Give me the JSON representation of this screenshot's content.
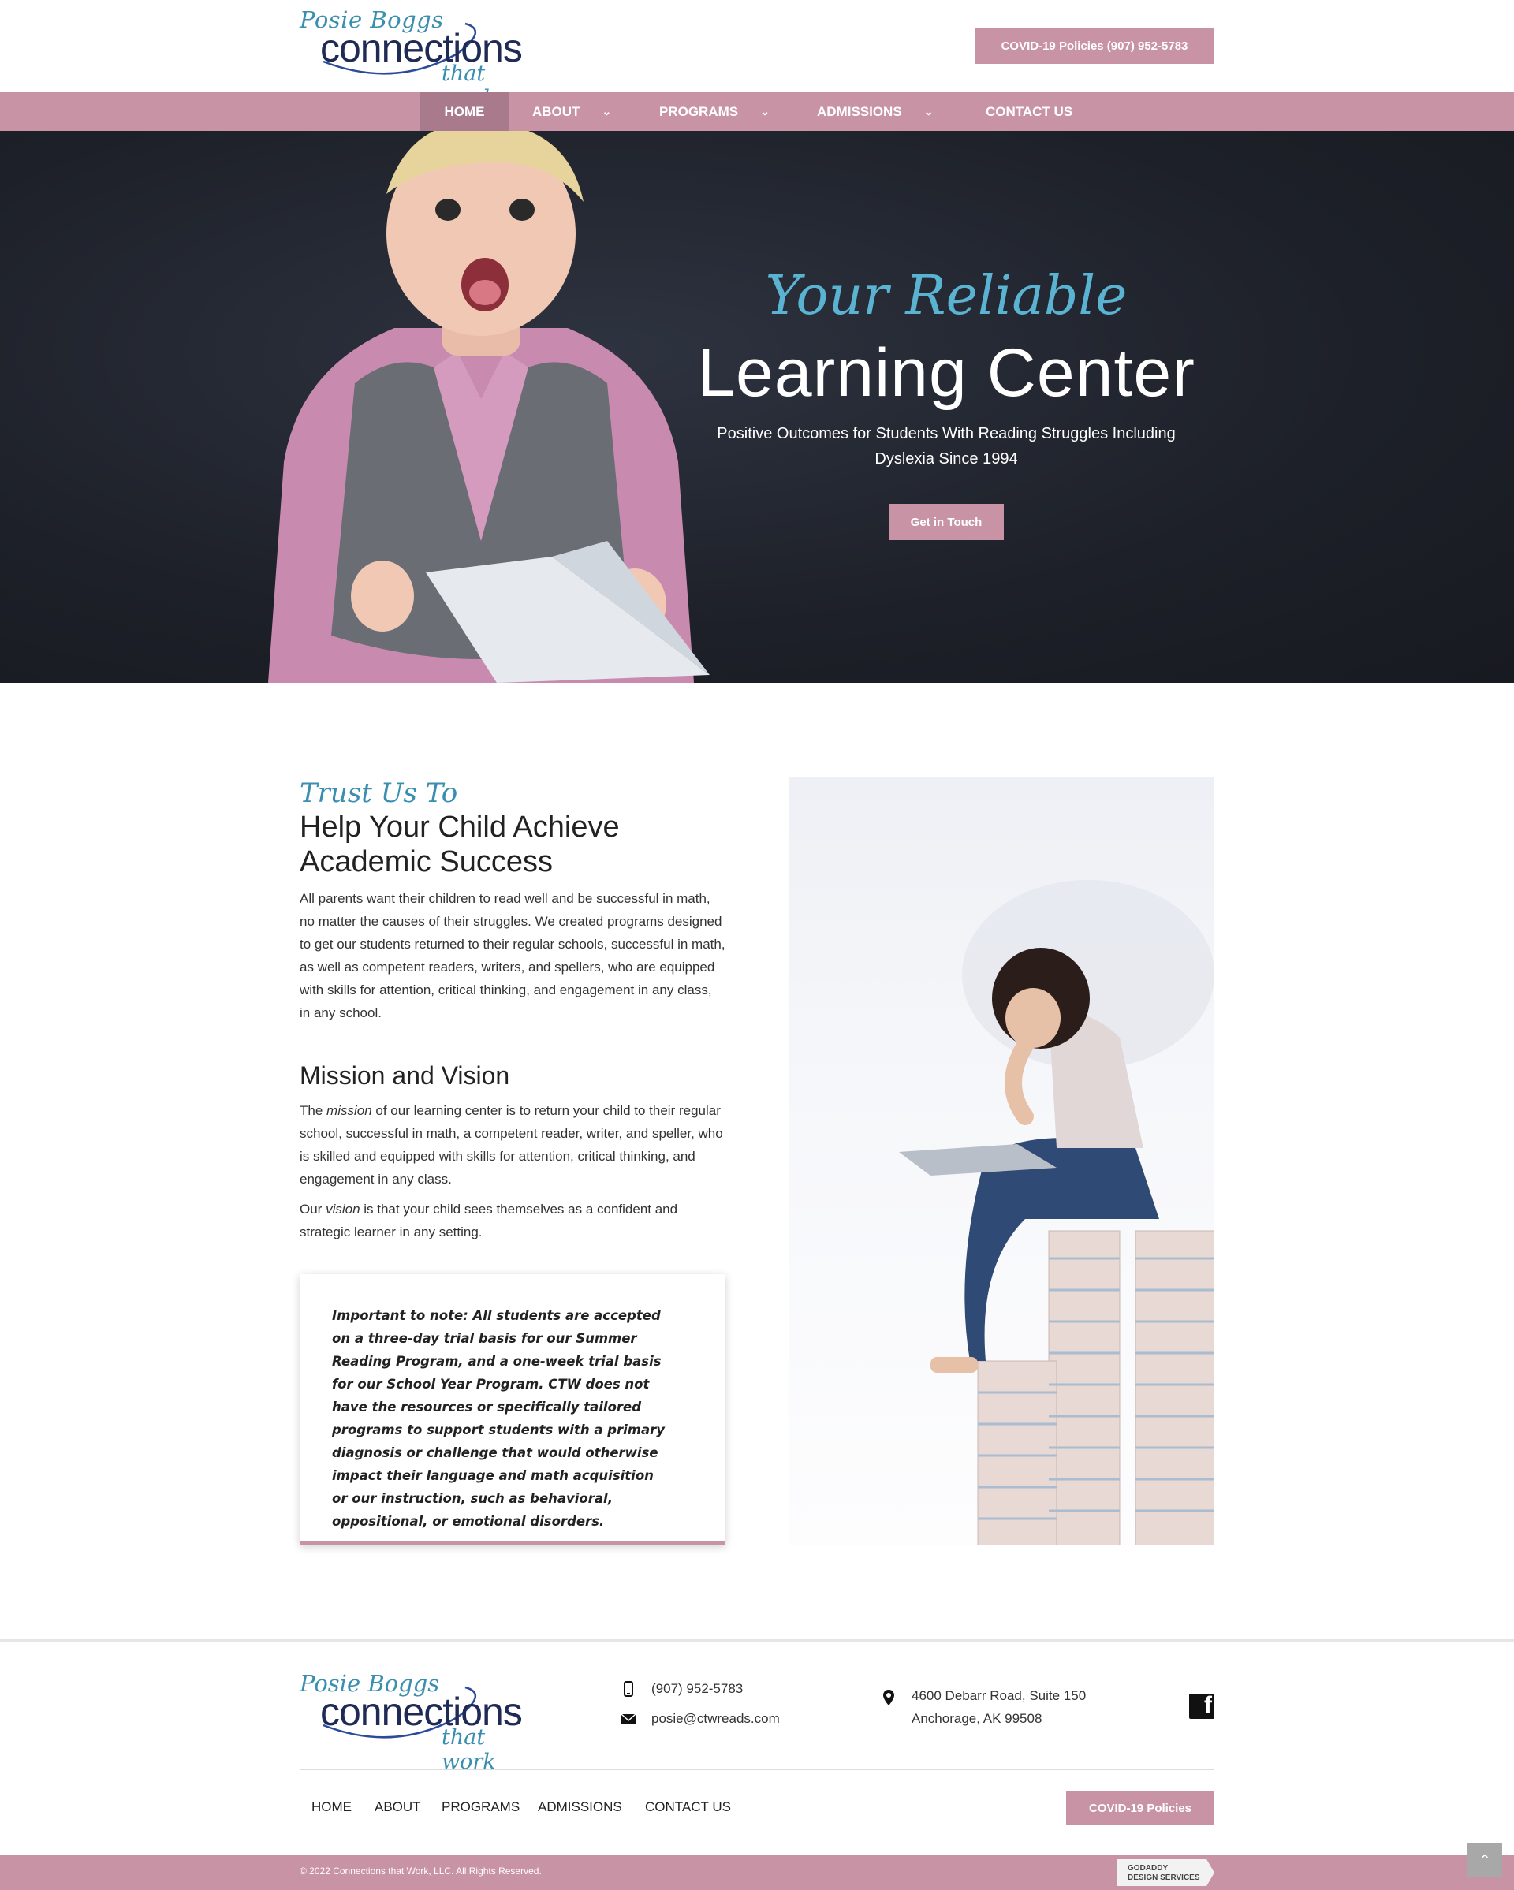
{
  "header": {
    "logo": {
      "script": "Posie Boggs",
      "main": "connections",
      "sub": "that work"
    },
    "covid_button": "COVID-19 Policies (907) 952-5783"
  },
  "nav": {
    "items": [
      {
        "label": "HOME",
        "active": true,
        "dropdown": false
      },
      {
        "label": "ABOUT",
        "active": false,
        "dropdown": true
      },
      {
        "label": "PROGRAMS",
        "active": false,
        "dropdown": true
      },
      {
        "label": "ADMISSIONS",
        "active": false,
        "dropdown": true
      },
      {
        "label": "CONTACT US",
        "active": false,
        "dropdown": false
      }
    ],
    "dropdown_icon": "chevron-down-icon"
  },
  "hero": {
    "script": "Your Reliable",
    "title": "Learning Center",
    "subtitle": "Positive Outcomes for Students With Reading Struggles Including Dyslexia Since 1994",
    "cta": "Get in Touch"
  },
  "about": {
    "script": "Trust Us To",
    "heading": "Help Your Child Achieve Academic Success",
    "body": "All parents want their children to read well and be successful in math, no matter the causes of their struggles. We created programs designed to get our students returned to their regular schools, successful in math, as well as competent readers, writers, and spellers, who are equipped with skills for attention, critical thinking, and engagement in any class, in any school.",
    "mission_heading": "Mission and Vision",
    "mission_pre": "The ",
    "mission_em": "mission",
    "mission_post": " of our learning center is to return your child to their regular school, successful in math, a competent reader, writer, and speller, who is skilled and equipped with skills for attention, critical thinking, and engagement in any class.",
    "vision_pre": "Our ",
    "vision_em": "vision",
    "vision_post": " is that your child sees themselves as a confident and strategic learner in any setting.",
    "note": "Important to note: All students are accepted on a three-day trial basis for our Summer Reading Program, and a one-week trial basis for our School Year Program. CTW does not have the resources or specifically tailored programs to support students with a primary diagnosis or challenge that would otherwise impact their language and math acquisition or our instruction, such as behavioral, oppositional, or emotional disorders."
  },
  "footer": {
    "phone": "(907) 952-5783",
    "email": "posie@ctwreads.com",
    "address_line1": "4600 Debarr Road, Suite 150",
    "address_line2": "Anchorage, AK 99508",
    "social_icon": "facebook-icon",
    "nav": [
      "HOME",
      "ABOUT",
      "PROGRAMS",
      "ADMISSIONS",
      "CONTACT US"
    ],
    "covid_button": "COVID-19 Policies",
    "copyright": "© 2022 Connections that Work, LLC. All Rights Reserved.",
    "badge_line1": "GODADDY",
    "badge_line2": "DESIGN SERVICES"
  },
  "colors": {
    "accent": "#c993a6",
    "accent_dark": "#a97a8b",
    "script_blue": "#3a8fb0",
    "hero_bg": "#1d2028"
  }
}
